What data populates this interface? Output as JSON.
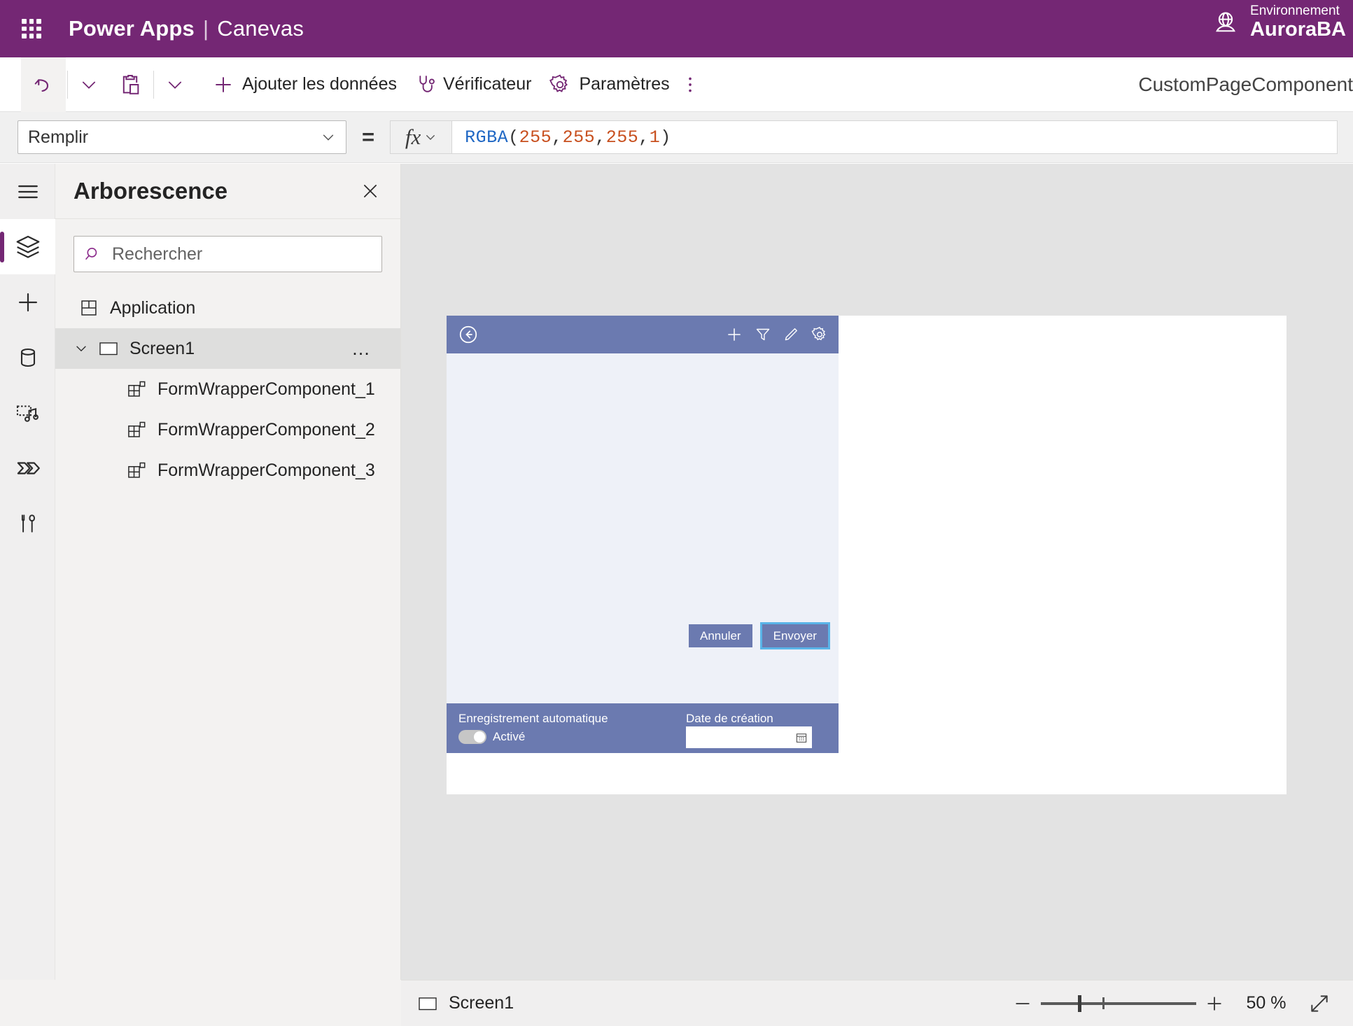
{
  "topbar": {
    "waffle_icon": "app-launcher-icon",
    "brand": "Power Apps",
    "separator": "|",
    "sub_brand": "Canevas",
    "environment_label": "Environnement",
    "environment_name": "AuroraBA",
    "globe_icon": "globe-icon",
    "background": "#742774"
  },
  "toolbar": {
    "undo_icon": "undo-icon",
    "undo_caret_icon": "chevron-down-icon",
    "paste_icon": "clipboard-paste-icon",
    "paste_caret_icon": "chevron-down-icon",
    "add_data_icon": "plus-icon",
    "add_data_label": "Ajouter les données",
    "checker_icon": "stethoscope-icon",
    "checker_label": "Vérificateur",
    "settings_icon": "gear-icon",
    "settings_label": "Paramètres",
    "overflow_icon": "more-vertical-icon",
    "document_title": "CustomPageComponent"
  },
  "formula_bar": {
    "property_value": "Remplir",
    "property_caret_icon": "chevron-down-icon",
    "equals": "=",
    "fx_label": "fx",
    "fx_caret_icon": "chevron-down-icon",
    "formula_tokens": [
      {
        "text": "RGBA",
        "kind": "fn"
      },
      {
        "text": "(",
        "kind": "punc"
      },
      {
        "text": "255",
        "kind": "num"
      },
      {
        "text": ", ",
        "kind": "punc"
      },
      {
        "text": "255",
        "kind": "num"
      },
      {
        "text": ", ",
        "kind": "punc"
      },
      {
        "text": "255",
        "kind": "num"
      },
      {
        "text": ", ",
        "kind": "punc"
      },
      {
        "text": "1",
        "kind": "num"
      },
      {
        "text": ")",
        "kind": "punc"
      }
    ],
    "formula_text": "RGBA(255, 255, 255, 1)"
  },
  "rail": {
    "items": [
      {
        "icon": "hamburger-menu-icon",
        "active": false
      },
      {
        "icon": "layers-tree-view-icon",
        "active": true
      },
      {
        "icon": "plus-insert-icon",
        "active": false
      },
      {
        "icon": "database-data-icon",
        "active": false
      },
      {
        "icon": "media-icon",
        "active": false
      },
      {
        "icon": "power-automate-icon",
        "active": false
      },
      {
        "icon": "variables-tools-icon",
        "active": false
      }
    ],
    "accent_color": "#742774"
  },
  "tree_panel": {
    "title": "Arborescence",
    "close_icon": "close-icon",
    "search": {
      "icon": "search-icon",
      "placeholder": "Rechercher",
      "value": ""
    },
    "items": [
      {
        "label": "Application",
        "icon": "app-grid-icon",
        "level": 0,
        "selected": false,
        "expandable": false
      },
      {
        "label": "Screen1",
        "icon": "screen-rect-icon",
        "level": 0,
        "selected": true,
        "expandable": true,
        "chevron": "chevron-down-icon",
        "overflow": "…"
      },
      {
        "label": "FormWrapperComponent_1",
        "icon": "component-icon",
        "level": 1,
        "selected": false,
        "expandable": false
      },
      {
        "label": "FormWrapperComponent_2",
        "icon": "component-icon",
        "level": 1,
        "selected": false,
        "expandable": false
      },
      {
        "label": "FormWrapperComponent_3",
        "icon": "component-icon",
        "level": 1,
        "selected": false,
        "expandable": false
      }
    ]
  },
  "app_preview": {
    "header": {
      "back_icon": "back-arrow-circle-icon",
      "icons": [
        "plus-icon",
        "filter-icon",
        "pencil-edit-icon",
        "gear-icon"
      ],
      "background": "#6b7ab0"
    },
    "body_background": "#eef1f8",
    "buttons": [
      {
        "label": "Annuler",
        "selected": false
      },
      {
        "label": "Envoyer",
        "selected": true
      }
    ],
    "selection_color": "#5ab4e8",
    "footer": {
      "autosave_label": "Enregistrement automatique",
      "toggle_state_label": "Activé",
      "toggle_on": false,
      "date_label": "Date de création",
      "date_value": "",
      "calendar_icon": "calendar-icon"
    }
  },
  "status_bar": {
    "screen_icon": "screen-rect-icon",
    "screen_label": "Screen1",
    "zoom_out_icon": "minus-icon",
    "zoom_in_icon": "plus-icon",
    "zoom_level": "50 %",
    "fullscreen_icon": "expand-diagonal-icon"
  }
}
